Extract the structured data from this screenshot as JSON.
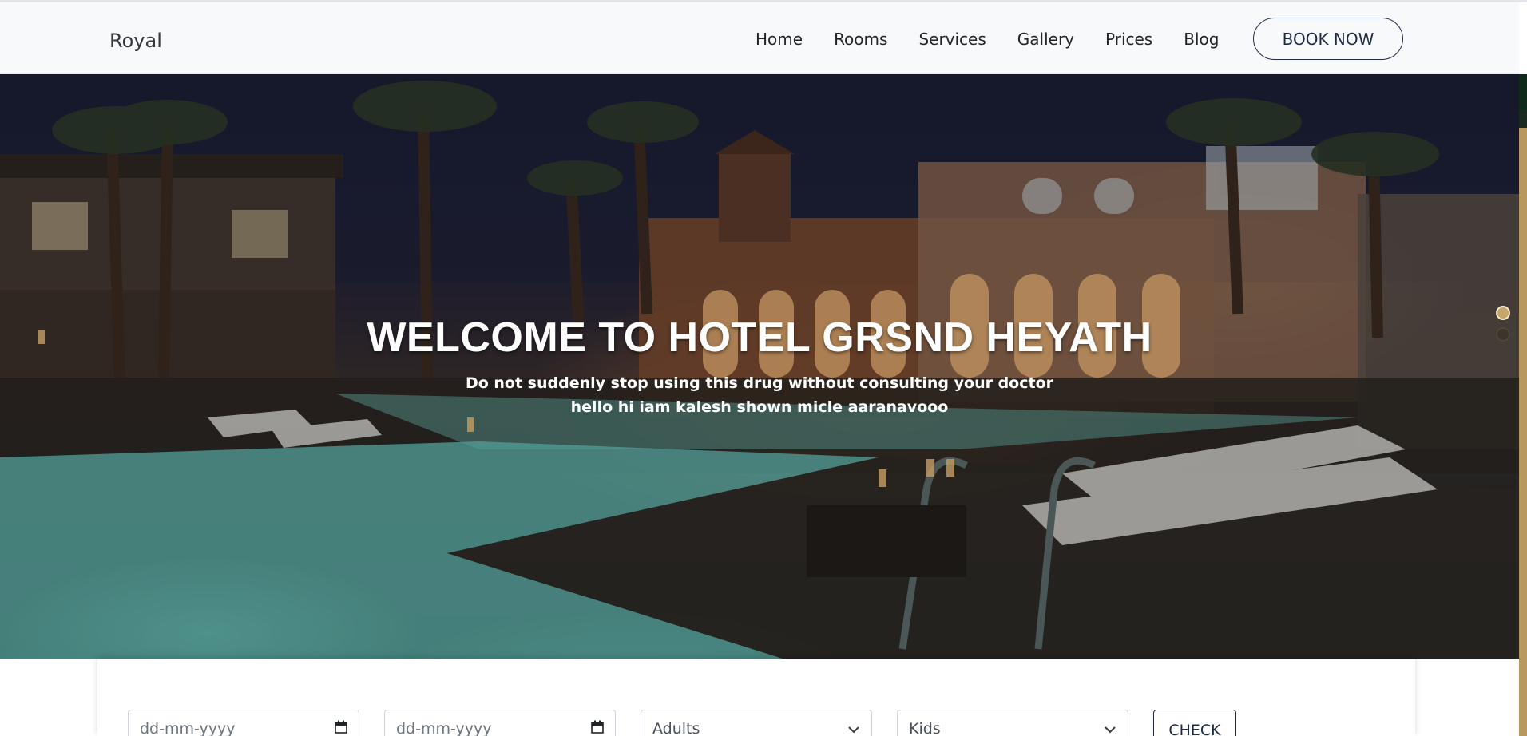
{
  "navbar": {
    "brand": "Royal",
    "links": [
      "Home",
      "Rooms",
      "Services",
      "Gallery",
      "Prices",
      "Blog"
    ],
    "book_label": "BOOK NOW"
  },
  "hero": {
    "title": "WELCOME TO HOTEL GRSND HEYATH",
    "subtitle_line1": "Do not suddenly stop using this drug without consulting your doctor",
    "subtitle_line2": "hello hi iam kalesh shown micle aaranavooo",
    "carousel": {
      "slides": 2,
      "active_index": 0
    }
  },
  "booking": {
    "checkin_placeholder": "dd-mm-yyyy",
    "checkout_placeholder": "dd-mm-yyyy",
    "adults_selected": "Adults",
    "kids_selected": "Kids",
    "check_label": "CHECK"
  },
  "colors": {
    "accent_dark": "#1f2b46",
    "carousel_active": "#c9a56a",
    "pool_teal": "#6ec8be"
  },
  "icons": {
    "calendar": "calendar-icon",
    "chevron": "chevron-down-icon"
  }
}
